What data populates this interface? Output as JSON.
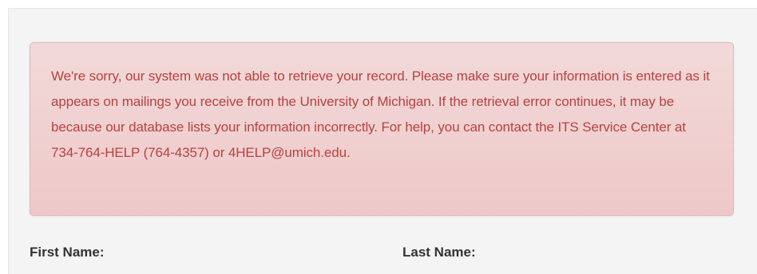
{
  "alert": {
    "message": "We're sorry, our system was not able to retrieve your record. Please make sure your information is entered as it appears on mailings you receive from the University of Michigan. If the retrieval error continues, it may be because our database lists your information incorrectly. For help, you can contact the ITS Service Center at 734-764-HELP (764-4357) or 4HELP@umich.edu.",
    "text_color": "#b8423f",
    "background_color": "#f2d9d9"
  },
  "form": {
    "first_name_label": "First Name:",
    "last_name_label": "Last Name:"
  }
}
